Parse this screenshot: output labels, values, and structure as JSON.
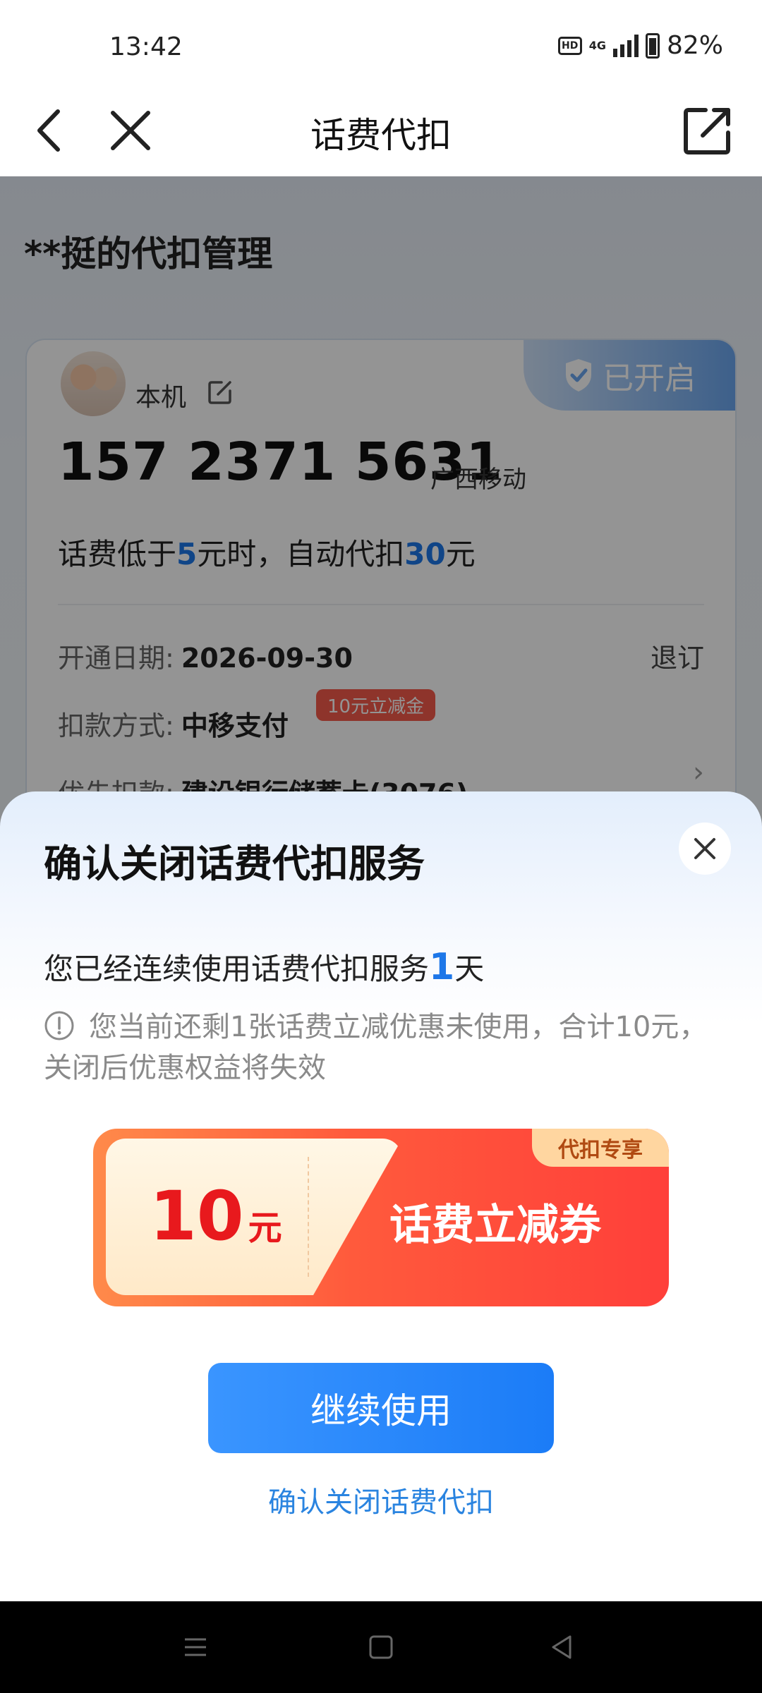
{
  "status_bar": {
    "time": "13:42",
    "hd": "HD",
    "network": "4G",
    "battery": "82%"
  },
  "nav": {
    "title": "话费代扣"
  },
  "background_page": {
    "heading": "**挺的代扣管理",
    "card": {
      "status_badge": "已开启",
      "owner": "本机",
      "phone": "157 2371 5631",
      "carrier": "广西移动",
      "desc_prefix": "话费低于",
      "desc_threshold": "5",
      "desc_middle": "元时，自动代扣",
      "desc_amount": "30",
      "desc_suffix": "元",
      "open_date_label": "开通日期:",
      "open_date": "2026-09-30",
      "unsubscribe": "退订",
      "pay_method_label": "扣款方式:",
      "pay_method": "中移支付",
      "promo_tag": "10元立减金",
      "priority_label": "优先扣款:",
      "priority_value": "建设银行储蓄卡(3076)"
    }
  },
  "sheet": {
    "title": "确认关闭话费代扣服务",
    "usage_prefix": "您已经连续使用话费代扣服务",
    "usage_days": "1",
    "usage_suffix": "天",
    "notice": "您当前还剩1张话费立减优惠未使用，合计10元，关闭后优惠权益将失效",
    "coupon": {
      "amount": "10",
      "unit": "元",
      "name": "话费立减券",
      "tag": "代扣专享"
    },
    "continue_button": "继续使用",
    "confirm_link": "确认关闭话费代扣"
  },
  "colors": {
    "accent_blue": "#1d77e8",
    "coupon_red": "#e8191d",
    "button_blue": "#1b7cf7"
  }
}
